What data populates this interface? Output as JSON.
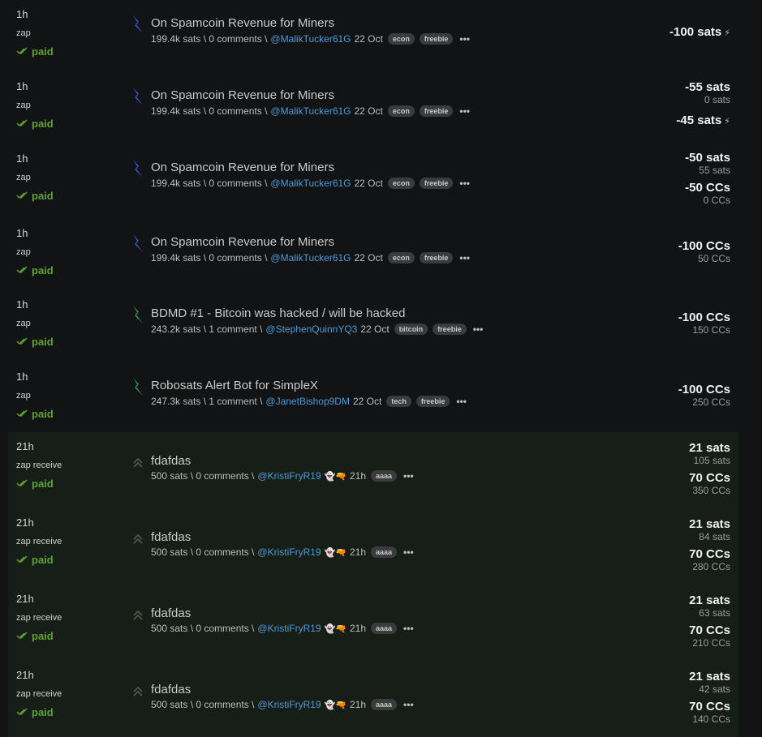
{
  "rows": [
    {
      "time": "1h",
      "type": "zap",
      "status": "paid",
      "title": "On Spamcoin Revenue for Miners",
      "stats": "199.4k sats \\ 0 comments \\",
      "user": "@MalikTucker61G",
      "date": "22 Oct",
      "tags": [
        "econ",
        "freebie"
      ],
      "icon": "lightning-blue-icon",
      "amounts": [
        {
          "text": "-100 sats",
          "kind": "big",
          "tail": "⚡"
        }
      ]
    },
    {
      "time": "1h",
      "type": "zap",
      "status": "paid",
      "title": "On Spamcoin Revenue for Miners",
      "stats": "199.4k sats \\ 0 comments \\",
      "user": "@MalikTucker61G",
      "date": "22 Oct",
      "tags": [
        "econ",
        "freebie"
      ],
      "icon": "lightning-blue-icon",
      "amounts": [
        {
          "text": "-55 sats",
          "kind": "big"
        },
        {
          "text": "0 sats",
          "kind": "small"
        },
        {
          "text": "-45 sats",
          "kind": "big",
          "tail": "⚡"
        }
      ]
    },
    {
      "time": "1h",
      "type": "zap",
      "status": "paid",
      "title": "On Spamcoin Revenue for Miners",
      "stats": "199.4k sats \\ 0 comments \\",
      "user": "@MalikTucker61G",
      "date": "22 Oct",
      "tags": [
        "econ",
        "freebie"
      ],
      "icon": "lightning-blue-icon",
      "amounts": [
        {
          "text": "-50 sats",
          "kind": "big"
        },
        {
          "text": "55 sats",
          "kind": "small"
        },
        {
          "text": "-50 CCs",
          "kind": "big"
        },
        {
          "text": "0 CCs",
          "kind": "small"
        }
      ]
    },
    {
      "time": "1h",
      "type": "zap",
      "status": "paid",
      "title": "On Spamcoin Revenue for Miners",
      "stats": "199.4k sats \\ 0 comments \\",
      "user": "@MalikTucker61G",
      "date": "22 Oct",
      "tags": [
        "econ",
        "freebie"
      ],
      "icon": "lightning-blue-icon",
      "amounts": [
        {
          "text": "-100 CCs",
          "kind": "big"
        },
        {
          "text": "50 CCs",
          "kind": "small"
        }
      ]
    },
    {
      "time": "1h",
      "type": "zap",
      "status": "paid",
      "title": "BDMD #1 - Bitcoin was hacked / will be hacked",
      "stats": "243.2k sats \\ 1 comment \\",
      "user": "@StephenQuinnYQ3",
      "date": "22 Oct",
      "tags": [
        "bitcoin",
        "freebie"
      ],
      "icon": "lightning-green-icon",
      "amounts": [
        {
          "text": "-100 CCs",
          "kind": "big"
        },
        {
          "text": "150 CCs",
          "kind": "small"
        }
      ]
    },
    {
      "time": "1h",
      "type": "zap",
      "status": "paid",
      "title": "Robosats Alert Bot for SimpleX",
      "stats": "247.3k sats \\ 1 comment \\",
      "user": "@JanetBishop9DM",
      "date": "22 Oct",
      "tags": [
        "tech",
        "freebie"
      ],
      "icon": "lightning-green-icon",
      "amounts": [
        {
          "text": "-100 CCs",
          "kind": "big"
        },
        {
          "text": "250 CCs",
          "kind": "small"
        }
      ]
    },
    {
      "time": "21h",
      "type": "zap receive",
      "status": "paid",
      "title": "fdafdas",
      "stats": "500 sats \\ 0 comments \\",
      "user": "@KristiFryR19",
      "date": "21h",
      "tags": [
        "aaaa"
      ],
      "icon": "double-chevron-up-icon",
      "receive": true,
      "amounts": [
        {
          "text": "21 sats",
          "kind": "big"
        },
        {
          "text": "105 sats",
          "kind": "small"
        },
        {
          "text": "70 CCs",
          "kind": "big"
        },
        {
          "text": "350 CCs",
          "kind": "small"
        }
      ]
    },
    {
      "time": "21h",
      "type": "zap receive",
      "status": "paid",
      "title": "fdafdas",
      "stats": "500 sats \\ 0 comments \\",
      "user": "@KristiFryR19",
      "date": "21h",
      "tags": [
        "aaaa"
      ],
      "icon": "double-chevron-up-icon",
      "receive": true,
      "amounts": [
        {
          "text": "21 sats",
          "kind": "big"
        },
        {
          "text": "84 sats",
          "kind": "small"
        },
        {
          "text": "70 CCs",
          "kind": "big"
        },
        {
          "text": "280 CCs",
          "kind": "small"
        }
      ]
    },
    {
      "time": "21h",
      "type": "zap receive",
      "status": "paid",
      "title": "fdafdas",
      "stats": "500 sats \\ 0 comments \\",
      "user": "@KristiFryR19",
      "date": "21h",
      "tags": [
        "aaaa"
      ],
      "icon": "double-chevron-up-icon",
      "receive": true,
      "amounts": [
        {
          "text": "21 sats",
          "kind": "big"
        },
        {
          "text": "63 sats",
          "kind": "small"
        },
        {
          "text": "70 CCs",
          "kind": "big"
        },
        {
          "text": "210 CCs",
          "kind": "small"
        }
      ]
    },
    {
      "time": "21h",
      "type": "zap receive",
      "status": "paid",
      "title": "fdafdas",
      "stats": "500 sats \\ 0 comments \\",
      "user": "@KristiFryR19",
      "date": "21h",
      "tags": [
        "aaaa"
      ],
      "icon": "double-chevron-up-icon",
      "receive": true,
      "amounts": [
        {
          "text": "21 sats",
          "kind": "big"
        },
        {
          "text": "42 sats",
          "kind": "small"
        },
        {
          "text": "70 CCs",
          "kind": "big"
        },
        {
          "text": "140 CCs",
          "kind": "small"
        }
      ]
    }
  ],
  "more_label": "•••",
  "ghost_glyph": "👻🔫"
}
